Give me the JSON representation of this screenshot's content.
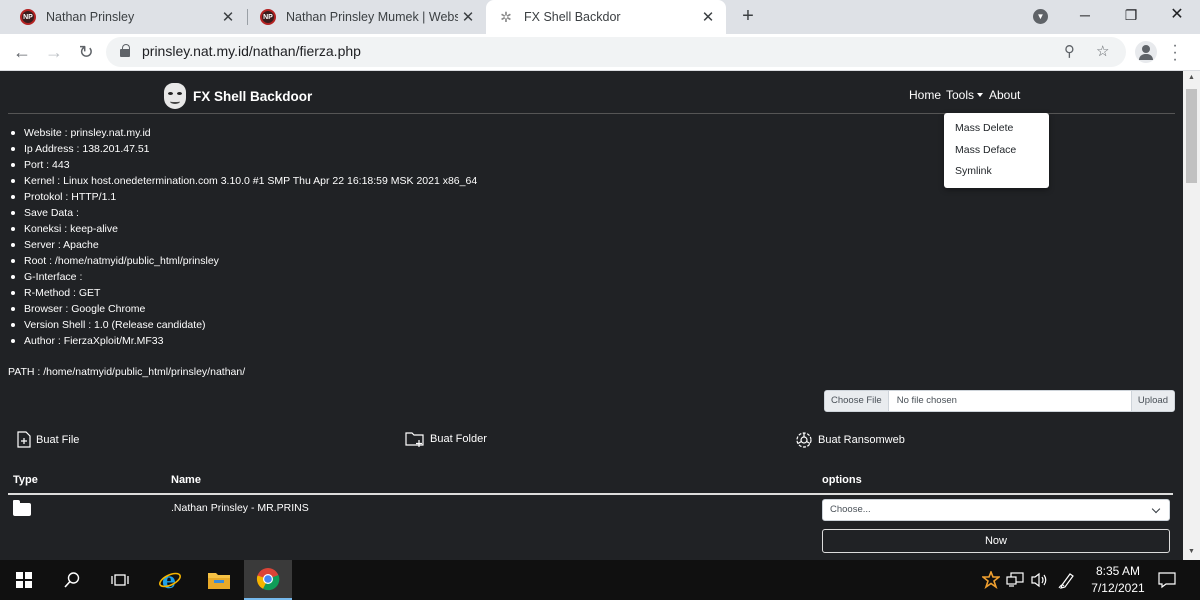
{
  "browser": {
    "tabs": [
      {
        "title": "Nathan Prinsley",
        "favicon": "NP"
      },
      {
        "title": "Nathan Prinsley Mumek | Website",
        "favicon": "NP"
      },
      {
        "title": "FX Shell Backdor",
        "favicon": "gear-icon"
      }
    ],
    "url": "prinsley.nat.my.id/nathan/fierza.php"
  },
  "site": {
    "brand": "FX Shell Backdoor",
    "nav": {
      "home": "Home",
      "tools": "Tools",
      "about": "About"
    },
    "tools_menu": [
      "Mass Delete",
      "Mass Deface",
      "Symlink"
    ]
  },
  "info": [
    "Website : prinsley.nat.my.id",
    "Ip Address : 138.201.47.51",
    "Port : 443",
    "Kernel : Linux host.onedetermination.com 3.10.0 #1 SMP Thu Apr 22 16:18:59 MSK 2021 x86_64",
    "Protokol : HTTP/1.1",
    "Save Data :",
    "Koneksi : keep-alive",
    "Server : Apache",
    "Root : /home/natmyid/public_html/prinsley",
    "G-Interface :",
    "R-Method : GET",
    "Browser : Google Chrome",
    "Version Shell : 1.0 (Release candidate)",
    "Author : FierzaXploit/Mr.MF33"
  ],
  "path": "PATH : /home/natmyid/public_html/prinsley/nathan/",
  "upload": {
    "choose": "Choose File",
    "no_file": "No file chosen",
    "button": "Upload"
  },
  "actions": {
    "file": "Buat File",
    "folder": "Buat Folder",
    "ransom": "Buat Ransomweb"
  },
  "table": {
    "headers": {
      "type": "Type",
      "name": "Name",
      "options": "options"
    },
    "rows": [
      {
        "name": ".Nathan Prinsley - MR.PRINS"
      }
    ],
    "select_value": "Choose...",
    "now": "Now"
  },
  "taskbar": {
    "time": "8:35 AM",
    "date": "7/12/2021"
  },
  "colors": {
    "page_bg": "#202225",
    "text": "#ffffff",
    "chrome_tabs": "#dee1e6"
  }
}
